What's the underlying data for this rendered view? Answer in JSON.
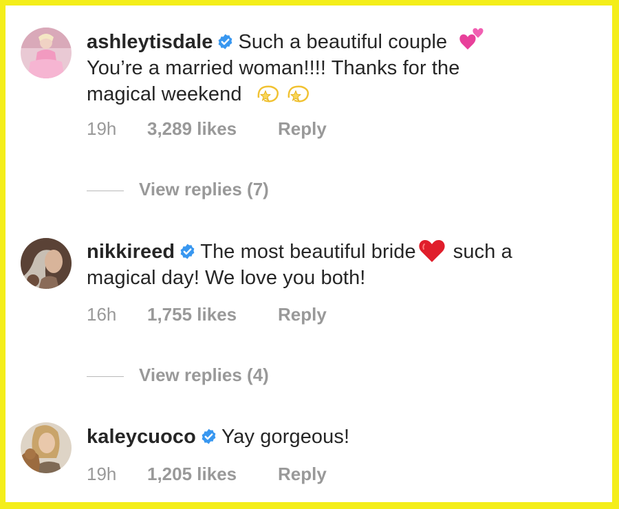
{
  "comments": [
    {
      "username": "ashleytisdale",
      "text_line1": "Such a beautiful couple",
      "text_rest_1": "You’re a married woman!!!! Thanks for the",
      "text_rest_2": "magical weekend",
      "time": "19h",
      "likes": "3,289 likes",
      "reply": "Reply",
      "view_replies": "View replies (7)"
    },
    {
      "username": "nikkireed",
      "text_line1": "The most beautiful bride",
      "text_line1_b": "such a",
      "text_rest_1": "magical day! We love you both!",
      "time": "16h",
      "likes": "1,755 likes",
      "reply": "Reply",
      "view_replies": "View replies (4)"
    },
    {
      "username": "kaleycuoco",
      "text_line1": "Yay gorgeous!",
      "time": "19h",
      "likes": "1,205 likes",
      "reply": "Reply"
    }
  ],
  "icons": {
    "verified": "verified-badge-icon",
    "hearts": "two-hearts-emoji",
    "dizzy": "dizzy-star-emoji",
    "red_heart": "red-heart-emoji"
  },
  "colors": {
    "frame": "#f4ee1a",
    "verified": "#3897f0",
    "muted": "#999999"
  }
}
